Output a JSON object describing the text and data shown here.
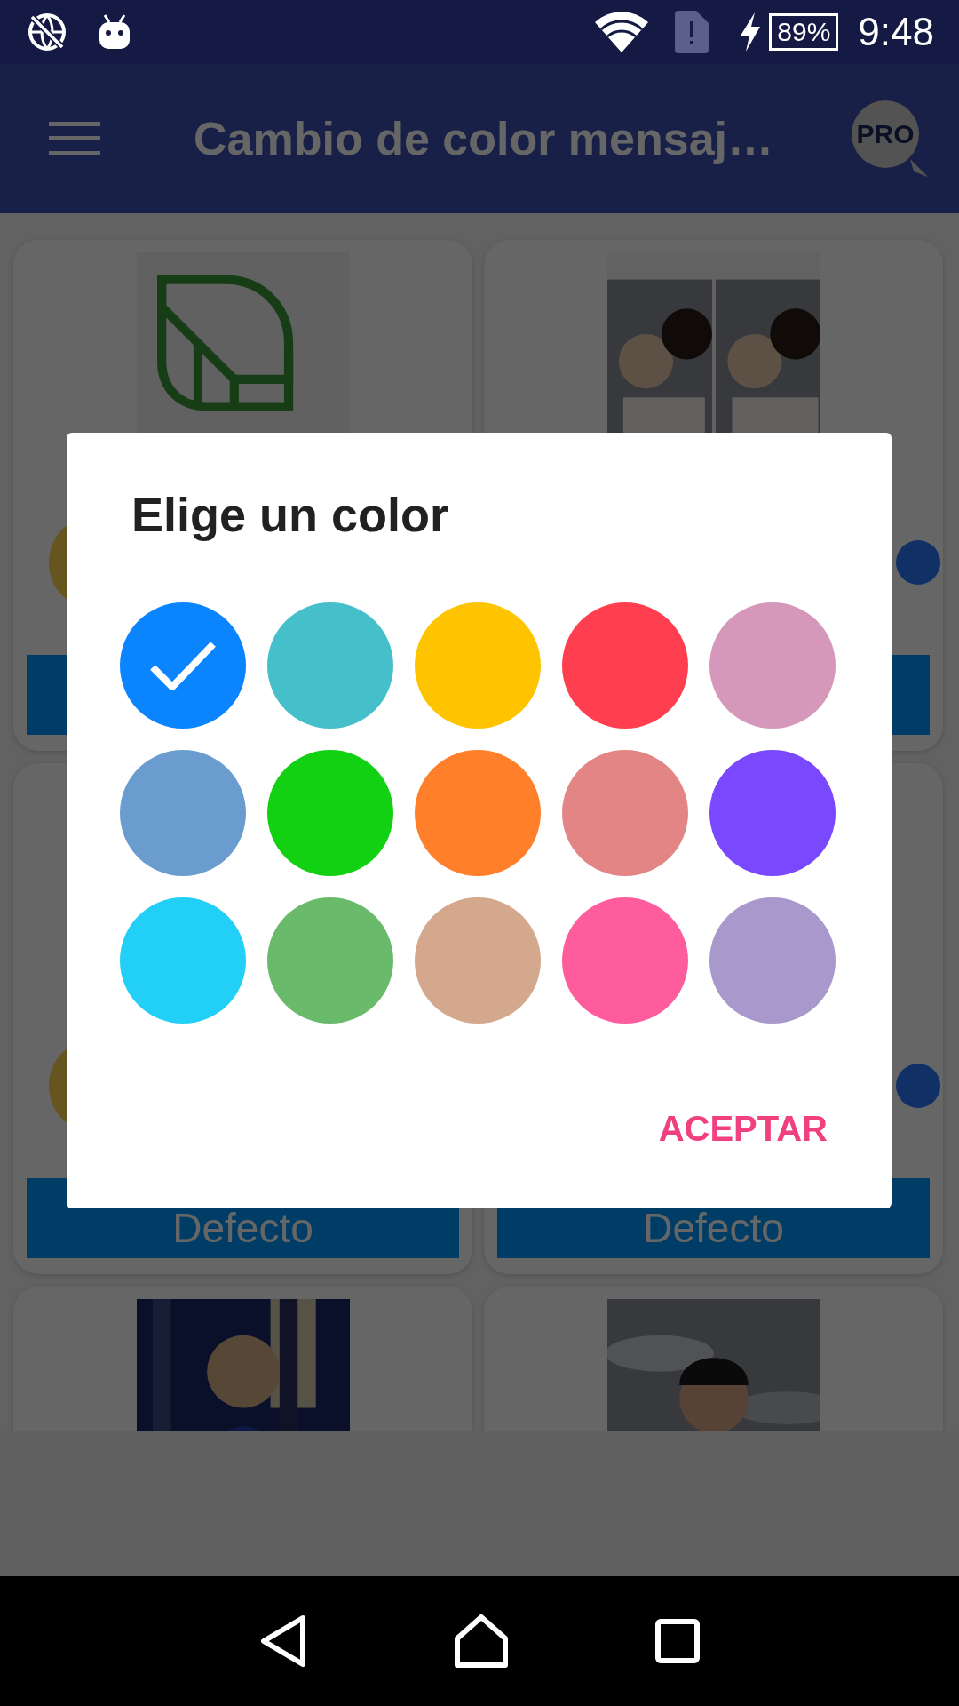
{
  "status_bar": {
    "battery": "89%",
    "time": "9:48"
  },
  "app_bar": {
    "title": "Cambio de color mensaj…",
    "badge": "PRO"
  },
  "cards": [
    {
      "image": {
        "kind": "picture"
      },
      "footer": true
    },
    {
      "image": {
        "kind": "picture"
      },
      "footer": true
    },
    {
      "footer": true,
      "button": "Defecto"
    },
    {
      "footer": true,
      "button": "Defecto"
    },
    {
      "image": {
        "kind": "picture"
      }
    },
    {
      "image": {
        "kind": "picture"
      }
    }
  ],
  "dialog": {
    "title": "Elige un color",
    "swatches": [
      {
        "color": "#0a84ff",
        "selected": true
      },
      {
        "color": "#45bfc9",
        "selected": false
      },
      {
        "color": "#ffc400",
        "selected": false
      },
      {
        "color": "#ff3f4f",
        "selected": false
      },
      {
        "color": "#d598bb",
        "selected": false
      },
      {
        "color": "#6a9ccf",
        "selected": false
      },
      {
        "color": "#12d012",
        "selected": false
      },
      {
        "color": "#ff7f2a",
        "selected": false
      },
      {
        "color": "#e48585",
        "selected": false
      },
      {
        "color": "#7a48ff",
        "selected": false
      },
      {
        "color": "#22cff7",
        "selected": false
      },
      {
        "color": "#6aba6b",
        "selected": false
      },
      {
        "color": "#d4a88c",
        "selected": false
      },
      {
        "color": "#ff5c9e",
        "selected": false
      },
      {
        "color": "#a898cb",
        "selected": false
      }
    ],
    "button": "ACEPTAR"
  }
}
